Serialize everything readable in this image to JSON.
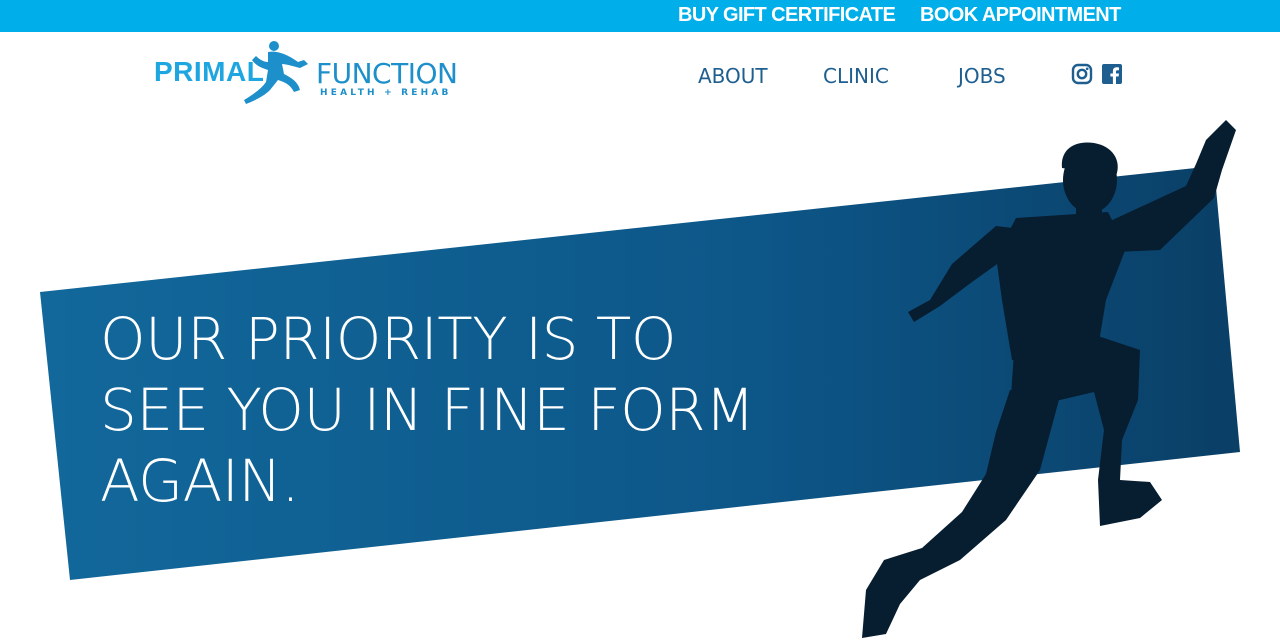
{
  "topbar": {
    "gift_label": "BUY GIFT CERTIFICATE",
    "book_label": "BOOK APPOINTMENT",
    "color": "#00aee9"
  },
  "logo": {
    "primary": "PRIMAL",
    "secondary": "FUNCTION",
    "tagline": "HEALTH + REHAB"
  },
  "nav": {
    "items": [
      {
        "label": "ABOUT"
      },
      {
        "label": "CLINIC"
      },
      {
        "label": "JOBS"
      }
    ]
  },
  "social": {
    "icons": [
      "instagram-icon",
      "facebook-icon"
    ]
  },
  "hero": {
    "lines": [
      "OUR PRIORITY IS TO",
      "SEE YOU IN FINE FORM",
      "AGAIN."
    ],
    "banner_colors": [
      "#12689b",
      "#0a3f66"
    ]
  }
}
